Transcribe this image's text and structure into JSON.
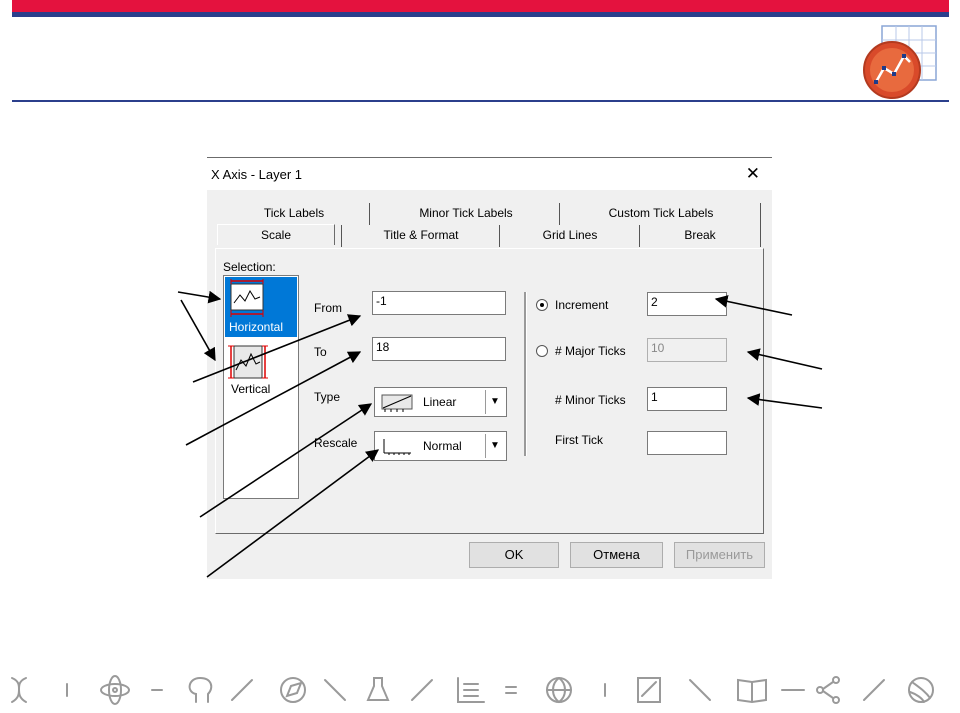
{
  "dialog": {
    "title": "X Axis - Layer 1",
    "close_glyph": "✕",
    "tabs_row1": [
      "Tick Labels",
      "Minor Tick Labels",
      "Custom Tick Labels"
    ],
    "tabs_row2": [
      "Scale",
      "Title & Format",
      "Grid Lines",
      "Break"
    ],
    "active_tab": "Scale",
    "selection": {
      "label": "Selection:",
      "items": [
        {
          "label": "Horizontal",
          "selected": true,
          "icon": "horizontal-axis-icon"
        },
        {
          "label": "Vertical",
          "selected": false,
          "icon": "vertical-axis-icon"
        }
      ]
    },
    "scale": {
      "from_label": "From",
      "from_value": "-1",
      "to_label": "To",
      "to_value": "18",
      "type_label": "Type",
      "type_value": "Linear",
      "rescale_label": "Rescale",
      "rescale_value": "Normal"
    },
    "ticks": {
      "increment_label": "Increment",
      "increment_value": "2",
      "increment_selected": true,
      "major_label": "# Major Ticks",
      "major_value": "10",
      "major_selected": false,
      "minor_label": "# Minor Ticks",
      "minor_value": "1",
      "first_label": "First Tick",
      "first_value": ""
    },
    "buttons": {
      "ok": "OK",
      "cancel": "Отмена",
      "apply": "Применить"
    }
  },
  "colors": {
    "brand_red": "#e4123e",
    "brand_blue": "#2b3f8c",
    "selection_blue": "#0078d7"
  },
  "footer_icons": [
    "dna-icon",
    "atom-icon",
    "brain-icon",
    "compass-icon",
    "flask-icon",
    "chart-icon",
    "globe-icon",
    "drawing-icon",
    "book-icon",
    "molecule-icon",
    "ball-icon"
  ]
}
